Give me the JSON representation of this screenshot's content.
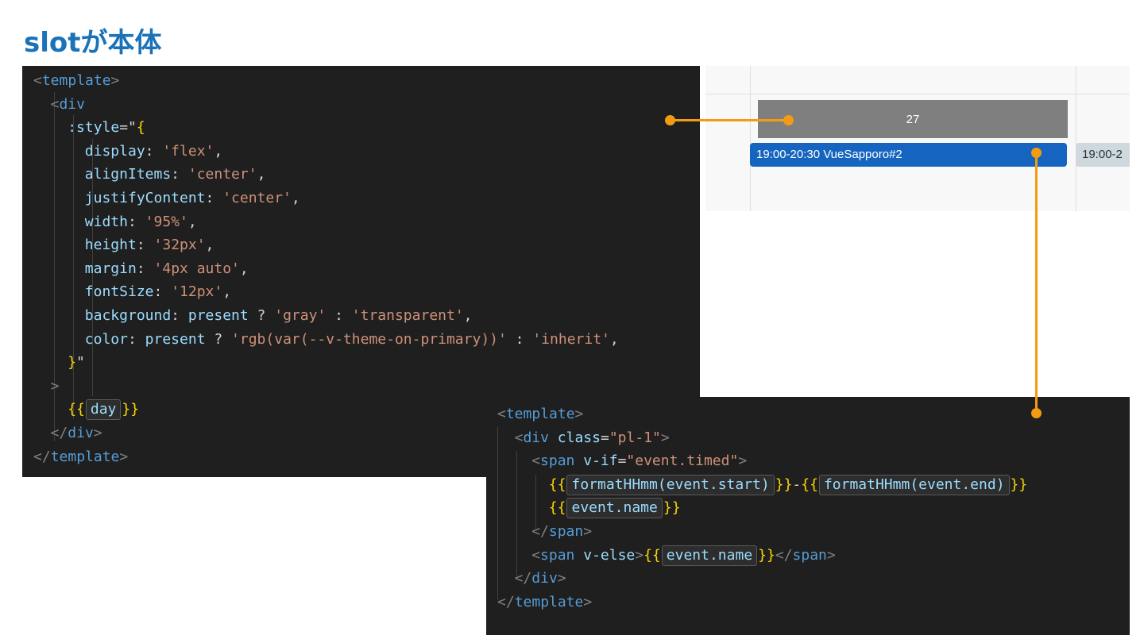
{
  "title": "slotが本体",
  "code_panel_1": {
    "lines": [
      [
        {
          "t": "<",
          "c": "bracket-tag"
        },
        {
          "t": "template",
          "c": "tag"
        },
        {
          "t": ">",
          "c": "bracket-tag"
        }
      ],
      [
        {
          "t": "<",
          "c": "bracket-tag"
        },
        {
          "t": "div",
          "c": "tag"
        }
      ],
      [
        {
          "t": ":style",
          "c": "attr"
        },
        {
          "t": "=\"",
          "c": "plain"
        },
        {
          "t": "{",
          "c": "brace"
        }
      ],
      [
        {
          "t": "display",
          "c": "attr"
        },
        {
          "t": ": ",
          "c": "plain"
        },
        {
          "t": "'flex'",
          "c": "str"
        },
        {
          "t": ",",
          "c": "plain"
        }
      ],
      [
        {
          "t": "alignItems",
          "c": "attr"
        },
        {
          "t": ": ",
          "c": "plain"
        },
        {
          "t": "'center'",
          "c": "str"
        },
        {
          "t": ",",
          "c": "plain"
        }
      ],
      [
        {
          "t": "justifyContent",
          "c": "attr"
        },
        {
          "t": ": ",
          "c": "plain"
        },
        {
          "t": "'center'",
          "c": "str"
        },
        {
          "t": ",",
          "c": "plain"
        }
      ],
      [
        {
          "t": "width",
          "c": "attr"
        },
        {
          "t": ": ",
          "c": "plain"
        },
        {
          "t": "'95%'",
          "c": "str"
        },
        {
          "t": ",",
          "c": "plain"
        }
      ],
      [
        {
          "t": "height",
          "c": "attr"
        },
        {
          "t": ": ",
          "c": "plain"
        },
        {
          "t": "'32px'",
          "c": "str"
        },
        {
          "t": ",",
          "c": "plain"
        }
      ],
      [
        {
          "t": "margin",
          "c": "attr"
        },
        {
          "t": ": ",
          "c": "plain"
        },
        {
          "t": "'4px auto'",
          "c": "str"
        },
        {
          "t": ",",
          "c": "plain"
        }
      ],
      [
        {
          "t": "fontSize",
          "c": "attr"
        },
        {
          "t": ": ",
          "c": "plain"
        },
        {
          "t": "'12px'",
          "c": "str"
        },
        {
          "t": ",",
          "c": "plain"
        }
      ],
      [
        {
          "t": "background",
          "c": "attr"
        },
        {
          "t": ": ",
          "c": "plain"
        },
        {
          "t": "present",
          "c": "attr"
        },
        {
          "t": " ? ",
          "c": "plain"
        },
        {
          "t": "'gray'",
          "c": "str"
        },
        {
          "t": " : ",
          "c": "plain"
        },
        {
          "t": "'transparent'",
          "c": "str"
        },
        {
          "t": ",",
          "c": "plain"
        }
      ],
      [
        {
          "t": "color",
          "c": "attr"
        },
        {
          "t": ": ",
          "c": "plain"
        },
        {
          "t": "present",
          "c": "attr"
        },
        {
          "t": " ? ",
          "c": "plain"
        },
        {
          "t": "'rgb(var(--v-theme-on-primary))'",
          "c": "str"
        },
        {
          "t": " : ",
          "c": "plain"
        },
        {
          "t": "'inherit'",
          "c": "str"
        },
        {
          "t": ",",
          "c": "plain"
        }
      ],
      [
        {
          "t": "}",
          "c": "brace"
        },
        {
          "t": "\"",
          "c": "plain"
        }
      ],
      [
        {
          "t": ">",
          "c": "bracket-tag"
        }
      ],
      [
        {
          "t": "{{",
          "c": "brace"
        },
        {
          "t": "day",
          "c": "interp"
        },
        {
          "t": "}}",
          "c": "brace"
        }
      ],
      [
        {
          "t": "</",
          "c": "bracket-tag"
        },
        {
          "t": "div",
          "c": "tag"
        },
        {
          "t": ">",
          "c": "bracket-tag"
        }
      ],
      [
        {
          "t": "</",
          "c": "bracket-tag"
        },
        {
          "t": "template",
          "c": "tag"
        },
        {
          "t": ">",
          "c": "bracket-tag"
        }
      ]
    ]
  },
  "code_panel_2": {
    "lines": [
      [
        {
          "t": "<",
          "c": "bracket-tag"
        },
        {
          "t": "template",
          "c": "tag"
        },
        {
          "t": ">",
          "c": "bracket-tag"
        }
      ],
      [
        {
          "t": "<",
          "c": "bracket-tag"
        },
        {
          "t": "div",
          "c": "tag"
        },
        {
          "t": " class",
          "c": "attr"
        },
        {
          "t": "=",
          "c": "plain"
        },
        {
          "t": "\"pl-1\"",
          "c": "str"
        },
        {
          "t": ">",
          "c": "bracket-tag"
        }
      ],
      [
        {
          "t": "<",
          "c": "bracket-tag"
        },
        {
          "t": "span",
          "c": "tag"
        },
        {
          "t": " v-if",
          "c": "attr"
        },
        {
          "t": "=",
          "c": "plain"
        },
        {
          "t": "\"event.timed\"",
          "c": "str"
        },
        {
          "t": ">",
          "c": "bracket-tag"
        }
      ],
      [
        {
          "t": "{{",
          "c": "brace"
        },
        {
          "t": "formatHHmm(event.start)",
          "c": "interp"
        },
        {
          "t": "}}",
          "c": "brace"
        },
        {
          "t": "-",
          "c": "plain"
        },
        {
          "t": "{{",
          "c": "brace"
        },
        {
          "t": "formatHHmm(event.end)",
          "c": "interp"
        },
        {
          "t": "}}",
          "c": "brace"
        }
      ],
      [
        {
          "t": "{{",
          "c": "brace"
        },
        {
          "t": "event.name",
          "c": "interp"
        },
        {
          "t": "}}",
          "c": "brace"
        }
      ],
      [
        {
          "t": "</",
          "c": "bracket-tag"
        },
        {
          "t": "span",
          "c": "tag"
        },
        {
          "t": ">",
          "c": "bracket-tag"
        }
      ],
      [
        {
          "t": "<",
          "c": "bracket-tag"
        },
        {
          "t": "span",
          "c": "tag"
        },
        {
          "t": " v-else",
          "c": "attr"
        },
        {
          "t": ">",
          "c": "bracket-tag"
        },
        {
          "t": "{{",
          "c": "brace"
        },
        {
          "t": "event.name",
          "c": "interp"
        },
        {
          "t": "}}",
          "c": "brace"
        },
        {
          "t": "</",
          "c": "bracket-tag"
        },
        {
          "t": "span",
          "c": "tag"
        },
        {
          "t": ">",
          "c": "bracket-tag"
        }
      ],
      [
        {
          "t": "</",
          "c": "bracket-tag"
        },
        {
          "t": "div",
          "c": "tag"
        },
        {
          "t": ">",
          "c": "bracket-tag"
        }
      ],
      [
        {
          "t": "</",
          "c": "bracket-tag"
        },
        {
          "t": "template",
          "c": "tag"
        },
        {
          "t": ">",
          "c": "bracket-tag"
        }
      ]
    ]
  },
  "calendar": {
    "day_number": "27",
    "event_primary": "19:00-20:30 VueSapporo#2",
    "event_secondary": "19:00-2"
  },
  "colors": {
    "title": "#1a72b8",
    "connector": "#f39c12",
    "event_primary": "#1565c0",
    "day_box": "#7f7f7f"
  }
}
